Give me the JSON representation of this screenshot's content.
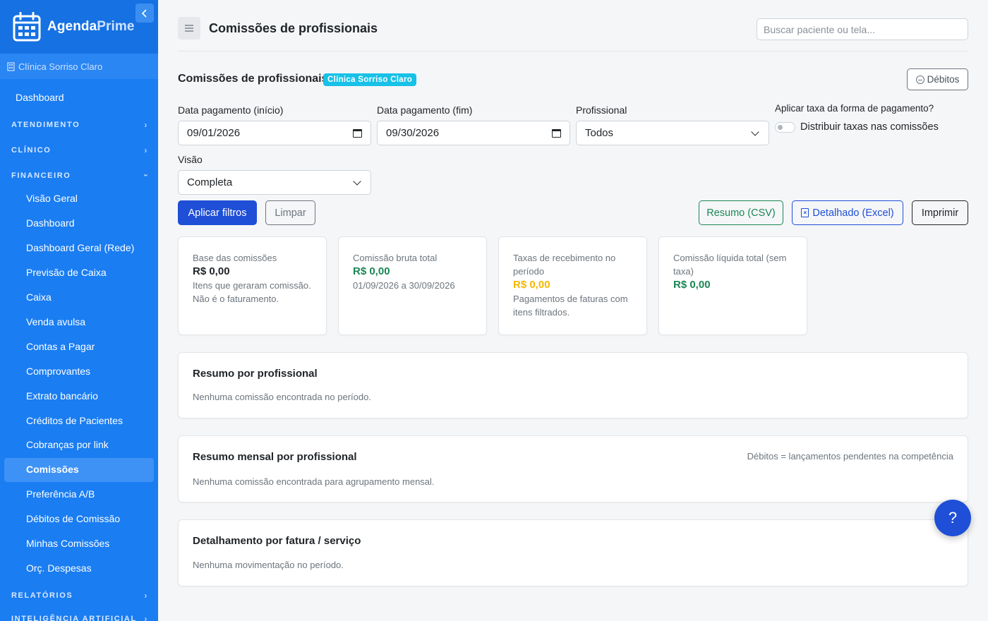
{
  "app": {
    "brand_part1": "Agenda",
    "brand_part2": "Prime",
    "collapse_icon": "chevron-left-icon",
    "clinic": "Clínica Sorriso Claro"
  },
  "sidebar": {
    "dashboard": "Dashboard",
    "sections": {
      "atendimento": "ATENDIMENTO",
      "clinico": "CLÍNICO",
      "financeiro": "FINANCEIRO",
      "relatorios": "RELATÓRIOS",
      "ia": "INTELIGÊNCIA ARTIFICIAL"
    },
    "financeiro_items": [
      "Visão Geral",
      "Dashboard",
      "Dashboard Geral (Rede)",
      "Previsão de Caixa",
      "Caixa",
      "Venda avulsa",
      "Contas a Pagar",
      "Comprovantes",
      "Extrato bancário",
      "Créditos de Pacientes",
      "Cobranças por link",
      "Comissões",
      "Preferência A/B",
      "Débitos de Comissão",
      "Minhas Comissões",
      "Orç. Despesas"
    ],
    "active_item": "Comissões"
  },
  "header": {
    "title": "Comissões de profissionais",
    "search_placeholder": "Buscar paciente ou tela..."
  },
  "section": {
    "title": "Comissões de profissionais",
    "badge": "Clínica Sorriso Claro",
    "debitos_button": "Débitos"
  },
  "filters": {
    "start_label": "Data pagamento (início)",
    "start_value": "09/01/2026",
    "end_label": "Data pagamento (fim)",
    "end_value": "09/30/2026",
    "professional_label": "Profissional",
    "professional_value": "Todos",
    "tax_label": "Aplicar taxa da forma de pagamento?",
    "tax_toggle_label": "Distribuir taxas nas comissões",
    "tax_toggle_on": false,
    "view_label": "Visão",
    "view_value": "Completa"
  },
  "actions": {
    "apply": "Aplicar filtros",
    "clear": "Limpar",
    "csv": "Resumo (CSV)",
    "excel": "Detalhado (Excel)",
    "print": "Imprimir"
  },
  "cards": [
    {
      "title": "Base das comissões",
      "value": "R$ 0,00",
      "subtitle": "Itens que geraram comissão. Não é o faturamento.",
      "value_color": "#212529"
    },
    {
      "title": "Comissão bruta total",
      "value": "R$ 0,00",
      "subtitle": "01/09/2026 a 30/09/2026",
      "value_color": "#198754"
    },
    {
      "title": "Taxas de recebimento no período",
      "value": "R$ 0,00",
      "subtitle": "Pagamentos de faturas com itens filtrados.",
      "value_color": "#f5b800"
    },
    {
      "title": "Comissão líquida total (sem taxa)",
      "value": "R$ 0,00",
      "subtitle": "",
      "value_color": "#198754"
    }
  ],
  "panels": {
    "resumo": {
      "title": "Resumo por profissional",
      "message": "Nenhuma comissão encontrada no período."
    },
    "mensal": {
      "title": "Resumo mensal por profissional",
      "note": "Débitos = lançamentos pendentes na competência",
      "message": "Nenhuma comissão encontrada para agrupamento mensal."
    },
    "detalhe": {
      "title": "Detalhamento por fatura / serviço",
      "message": "Nenhuma movimentação no período."
    }
  },
  "help": {
    "label": "?"
  },
  "colors": {
    "sidebar": "#1a7df2",
    "primary": "#1f4fd6",
    "success": "#198754",
    "warning": "#f5b800",
    "badge": "#17c1e8"
  }
}
